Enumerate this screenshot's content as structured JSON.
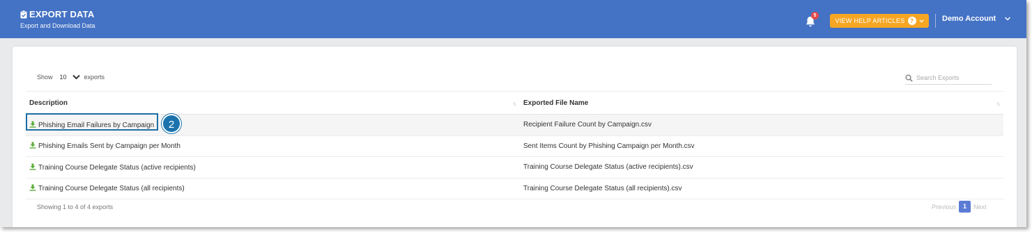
{
  "header": {
    "title": "EXPORT DATA",
    "subtitle": "Export and Download Data",
    "notifications_count": "5",
    "help_button_label": "VIEW HELP ARTICLES",
    "help_icon": "?",
    "account_name": "Demo Account",
    "colors": {
      "bar": "#4472c4",
      "help_button": "#f6a623",
      "badge": "#e34a4a"
    }
  },
  "controls": {
    "show_label": "Show",
    "page_size": "10",
    "exports_label": "exports",
    "search_placeholder": "Search Exports"
  },
  "table": {
    "columns": [
      "Description",
      "Exported File Name"
    ],
    "rows": [
      {
        "description": "Phishing Email Failures by Campaign",
        "file": "Recipient Failure Count by Campaign.csv"
      },
      {
        "description": "Phishing Emails Sent by Campaign per Month",
        "file": "Sent Items Count by Phishing Campaign per Month.csv"
      },
      {
        "description": "Training Course Delegate Status (active recipients)",
        "file": "Training Course Delegate Status (active recipients).csv"
      },
      {
        "description": "Training Course Delegate Status (all recipients)",
        "file": "Training Course Delegate Status (all recipients).csv"
      }
    ]
  },
  "footer": {
    "info": "Showing 1 to 4 of 4 exports",
    "previous": "Previous",
    "current_page": "1",
    "next": "Next"
  },
  "annotation": {
    "callout_number": "2"
  }
}
